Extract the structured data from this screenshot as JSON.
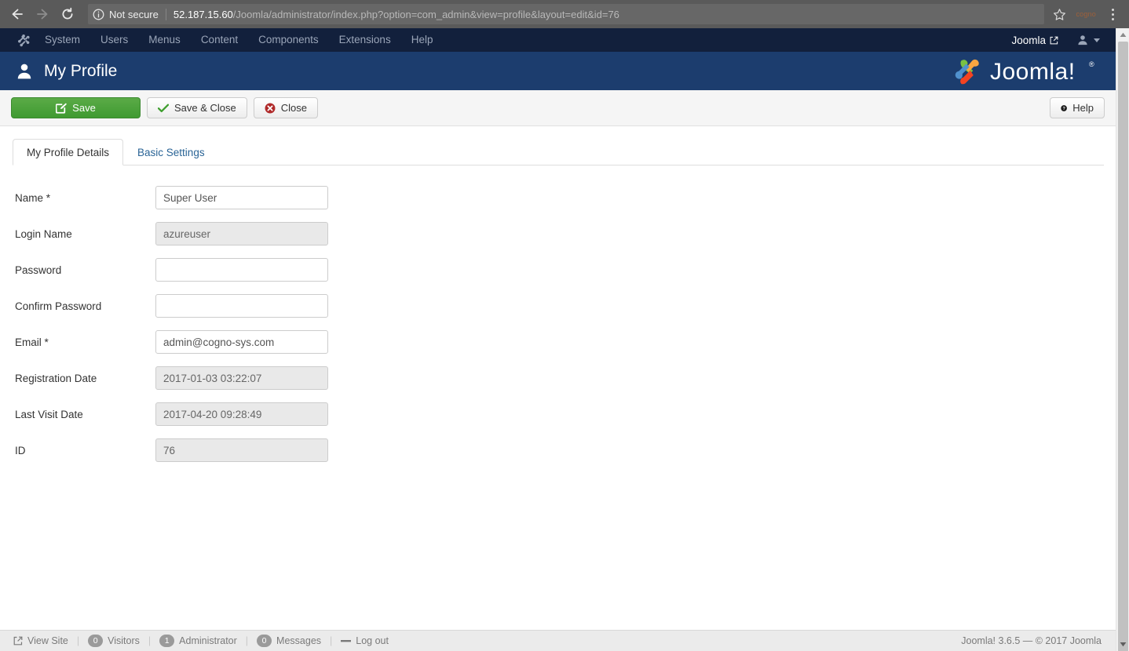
{
  "browser": {
    "back_icon": "arrow-left-icon",
    "forward_icon": "arrow-right-icon",
    "reload_icon": "reload-icon",
    "info_icon": "info-circle-icon",
    "security_label": "Not secure",
    "url_host": "52.187.15.60",
    "url_path": "/Joomla/administrator/index.php?option=com_admin&view=profile&layout=edit&id=76",
    "url_full": "52.187.15.60/Joomla/administrator/index.php?option=com_admin&view=profile&layout=edit&id=76",
    "bookmark_icon": "star-icon",
    "extension_badge": "cogno",
    "menu_icon": "kebab-menu-icon"
  },
  "admin_bar": {
    "brand_icon": "joomla-brand-icon",
    "menu": [
      {
        "label": "System"
      },
      {
        "label": "Users"
      },
      {
        "label": "Menus"
      },
      {
        "label": "Content"
      },
      {
        "label": "Components"
      },
      {
        "label": "Extensions"
      },
      {
        "label": "Help"
      }
    ],
    "site_link_label": "Joomla",
    "site_link_icon": "external-link-icon",
    "user_icon": "user-icon",
    "user_caret_icon": "chevron-down-icon"
  },
  "header": {
    "title": "My Profile",
    "title_icon": "user-icon",
    "logo_text": "Joomla!",
    "logo_icon": "joomla-logo-icon"
  },
  "toolbar": {
    "save_label": "Save",
    "save_icon": "edit-square-icon",
    "save_close_label": "Save & Close",
    "save_close_icon": "check-icon",
    "close_label": "Close",
    "close_icon": "remove-circle-icon",
    "help_label": "Help",
    "help_icon": "question-circle-icon"
  },
  "tabs": [
    {
      "label": "My Profile Details",
      "active": true
    },
    {
      "label": "Basic Settings",
      "active": false
    }
  ],
  "form": {
    "fields": [
      {
        "label": "Name *",
        "value": "Super User",
        "readonly": false,
        "name": "name"
      },
      {
        "label": "Login Name",
        "value": "azureuser",
        "readonly": true,
        "name": "login-name"
      },
      {
        "label": "Password",
        "value": "",
        "readonly": false,
        "name": "password"
      },
      {
        "label": "Confirm Password",
        "value": "",
        "readonly": false,
        "name": "confirm-password"
      },
      {
        "label": "Email *",
        "value": "admin@cogno-sys.com",
        "readonly": false,
        "name": "email"
      },
      {
        "label": "Registration Date",
        "value": "2017-01-03 03:22:07",
        "readonly": true,
        "name": "registration-date"
      },
      {
        "label": "Last Visit Date",
        "value": "2017-04-20 09:28:49",
        "readonly": true,
        "name": "last-visit-date"
      },
      {
        "label": "ID",
        "value": "76",
        "readonly": true,
        "name": "id"
      }
    ]
  },
  "status_bar": {
    "view_site_label": "View Site",
    "view_site_icon": "external-link-icon",
    "visitors_count": "0",
    "visitors_label": "Visitors",
    "administrator_count": "1",
    "administrator_label": "Administrator",
    "messages_count": "0",
    "messages_label": "Messages",
    "logout_label": "Log out",
    "logout_icon": "minus-icon",
    "copyright": "Joomla! 3.6.5  —  © 2017 Joomla"
  },
  "colors": {
    "admin_bar": "#12203c",
    "header": "#1c3d6e",
    "save_green": "#4a9e38",
    "link_blue": "#2a6496",
    "close_red": "#b02a2a"
  }
}
